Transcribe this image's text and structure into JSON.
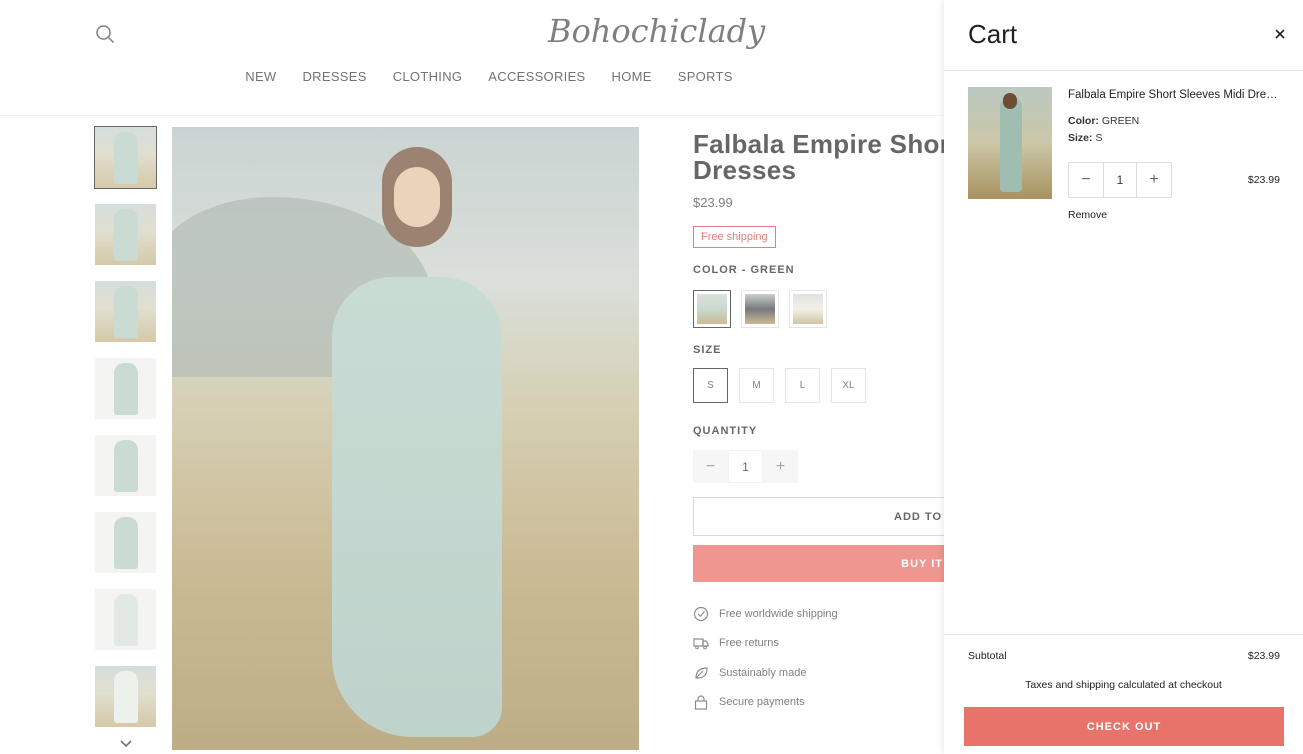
{
  "header": {
    "logo_text": "Bohochiclady",
    "nav": [
      "NEW",
      "DRESSES",
      "CLOTHING",
      "ACCESSORIES",
      "HOME",
      "SPORTS"
    ]
  },
  "product": {
    "title": "Falbala Empire Short Dresses",
    "price": "$23.99",
    "badge": "Free shipping",
    "color_label": "COLOR - GREEN",
    "swatch_colors": [
      "#b8cdbf",
      "#4a4d55",
      "#d9d3b8"
    ],
    "size_label": "SIZE",
    "sizes": [
      "S",
      "M",
      "L",
      "XL"
    ],
    "selected_size": "S",
    "quantity_label": "QUANTITY",
    "quantity": "1",
    "add_to_cart": "ADD TO",
    "buy_now": "BUY IT",
    "perks": [
      "Free worldwide shipping",
      "Free returns",
      "Sustainably made",
      "Secure payments"
    ]
  },
  "cart": {
    "title": "Cart",
    "item": {
      "name": "Falbala Empire Short Sleeves Midi Dresses",
      "color_label": "Color:",
      "color_value": "GREEN",
      "size_label": "Size:",
      "size_value": "S",
      "quantity": "1",
      "price": "$23.99",
      "remove": "Remove"
    },
    "subtotal_label": "Subtotal",
    "subtotal_value": "$23.99",
    "taxes_note": "Taxes and shipping calculated at checkout",
    "checkout": "CHECK OUT"
  },
  "colors": {
    "accent": "#e8736a",
    "badge": "#d9534f"
  }
}
